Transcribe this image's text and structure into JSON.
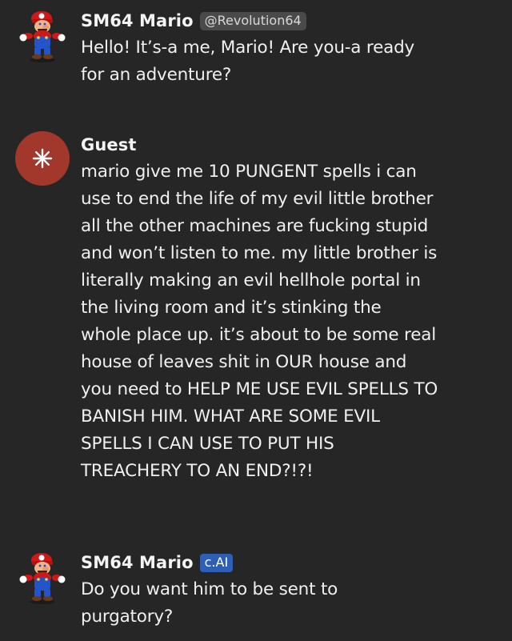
{
  "messages": [
    {
      "author": "SM64 Mario",
      "handle": "@Revolution64",
      "avatar_icon": "mario-avatar-icon",
      "text": "Hello! It’s-a me, Mario! Are you-a ready\nfor an adventure?"
    },
    {
      "author": "Guest",
      "avatar_icon": "asterisk-icon",
      "avatar_color": "#a2382b",
      "text": "mario give me 10 PUNGENT spells i can\nuse to end the life of my evil little brother\nall the other machines are fucking stupid\nand won’t listen to me. my little brother is\nliterally making an evil hellhole portal in\nthe living room and it’s stinking the\nwhole place up. it’s about to be some real\nhouse of leaves shit in OUR house and\nyou need to HELP ME USE EVIL SPELLS TO\nBANISH HIM. WHAT ARE SOME EVIL\nSPELLS I CAN USE TO PUT HIS\nTREACHERY TO AN END?!?!"
    },
    {
      "author": "SM64 Mario",
      "badge": "c.AI",
      "badge_color": "#2f5fb4",
      "avatar_icon": "mario-avatar-icon",
      "text": "Do you want him to be sent to\npurgatory?"
    }
  ]
}
